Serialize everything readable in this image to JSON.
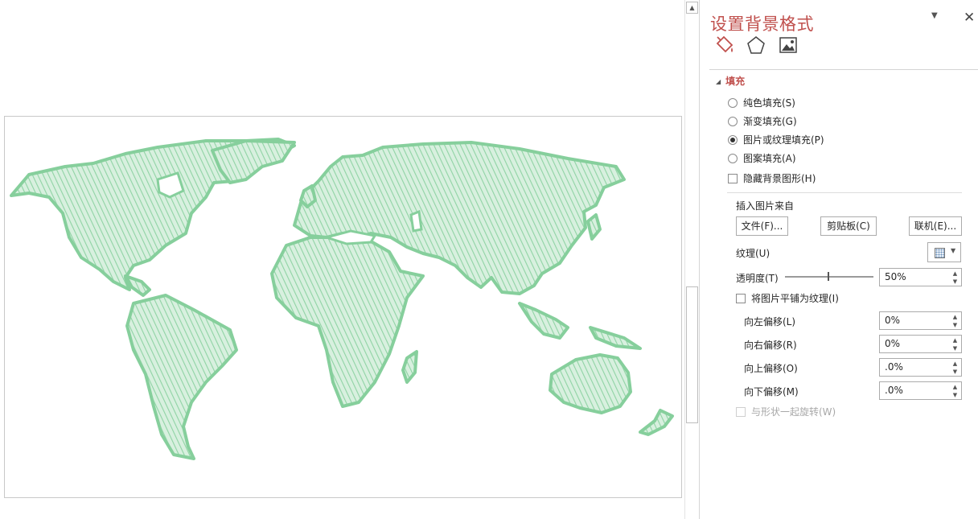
{
  "pane": {
    "title": "设置背景格式",
    "menu_icon": "chevron-down-icon",
    "close_icon": "close-icon",
    "tabs": [
      {
        "name": "fill-line-tab",
        "icon": "paint-bucket-icon",
        "active": true
      },
      {
        "name": "effects-tab",
        "icon": "pentagon-icon",
        "active": false
      },
      {
        "name": "picture-tab",
        "icon": "picture-icon",
        "active": false
      }
    ],
    "section_title": "填充",
    "fill_options": [
      {
        "label": "纯色填充(S)",
        "selected": false
      },
      {
        "label": "渐变填充(G)",
        "selected": false
      },
      {
        "label": "图片或纹理填充(P)",
        "selected": true
      },
      {
        "label": "图案填充(A)",
        "selected": false
      }
    ],
    "hide_background_graphics": "隐藏背景图形(H)",
    "insert_picture_from": "插入图片来自",
    "buttons": {
      "file": "文件(F)...",
      "clipboard": "剪贴板(C)",
      "online": "联机(E)..."
    },
    "texture_label": "纹理(U)",
    "transparency_label": "透明度(T)",
    "transparency_value": "50%",
    "tile_label": "将图片平铺为纹理(I)",
    "offsets": [
      {
        "label": "向左偏移(L)",
        "value": "0%"
      },
      {
        "label": "向右偏移(R)",
        "value": "0%"
      },
      {
        "label": "向上偏移(O)",
        "value": ".0%"
      },
      {
        "label": "向下偏移(M)",
        "value": ".0%"
      }
    ],
    "rotate_with_shape": "与形状一起旋转(W)"
  },
  "colors": {
    "accent": "#c0504d",
    "map_green": "#8fd3a4",
    "map_stroke": "#86cf9c"
  },
  "slide": {
    "background_image": "world-map-sketch"
  }
}
